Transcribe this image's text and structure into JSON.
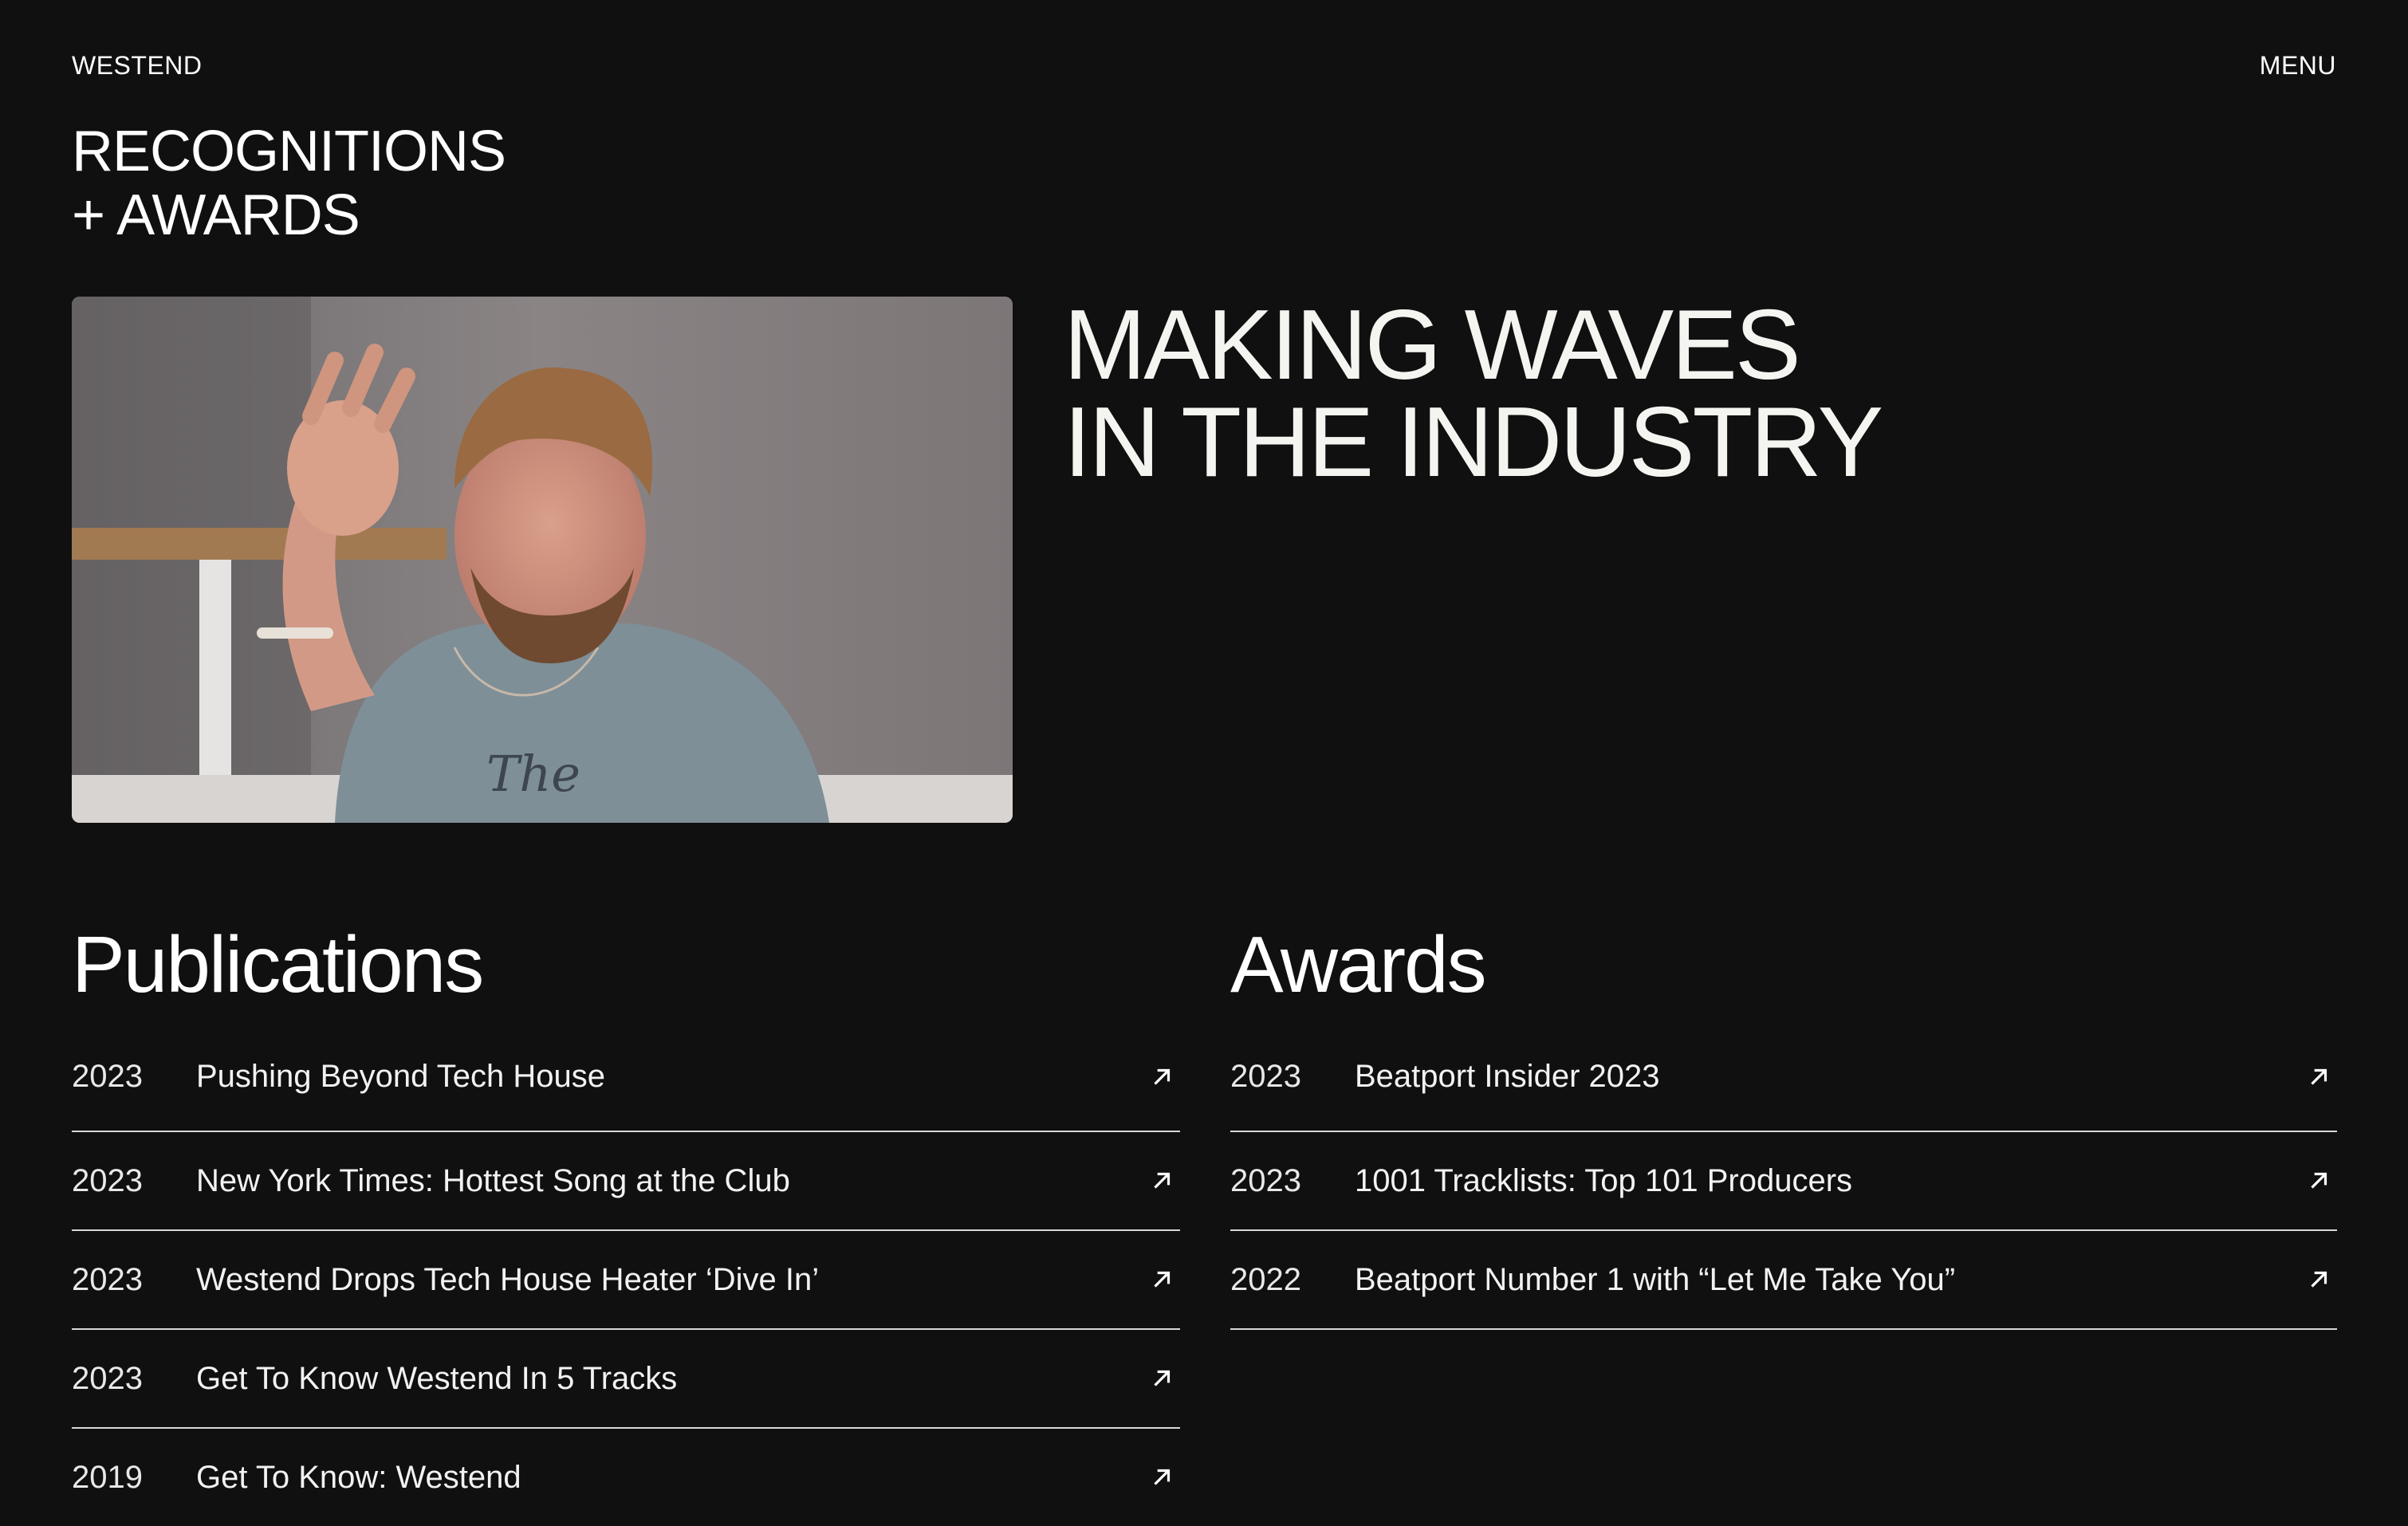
{
  "header": {
    "brand": "WESTEND",
    "menu_label": "MENU"
  },
  "page": {
    "title_line1": "RECOGNITIONS",
    "title_line2": "+ AWARDS"
  },
  "hero": {
    "headline_line1": "MAKING WAVES",
    "headline_line2": "IN THE INDUSTRY"
  },
  "publications": {
    "heading": "Publications",
    "items": [
      {
        "year": "2023",
        "title": "Pushing Beyond Tech House"
      },
      {
        "year": "2023",
        "title": "New York Times: Hottest Song at the Club"
      },
      {
        "year": "2023",
        "title": "Westend Drops Tech House Heater ‘Dive In’"
      },
      {
        "year": "2023",
        "title": "Get To Know Westend In 5 Tracks"
      },
      {
        "year": "2019",
        "title": "Get To Know: Westend"
      }
    ]
  },
  "awards": {
    "heading": "Awards",
    "items": [
      {
        "year": "2023",
        "title": "Beatport Insider 2023"
      },
      {
        "year": "2023",
        "title": "1001 Tracklists: Top 101 Producers"
      },
      {
        "year": "2022",
        "title": "Beatport Number 1 with “Let Me Take You”"
      }
    ]
  },
  "icons": {
    "row_link": "arrow-up-right-icon"
  },
  "colors": {
    "background": "#101010",
    "text": "#ffffff",
    "divider": "#d8d8d8"
  }
}
